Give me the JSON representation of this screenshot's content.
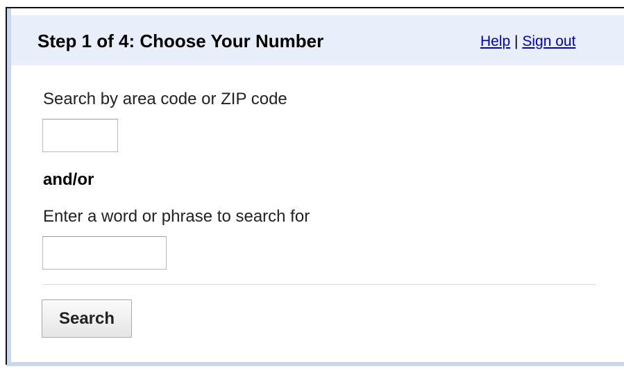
{
  "header": {
    "title": "Step 1 of 4: Choose Your Number",
    "links": {
      "help": "Help",
      "separator": "|",
      "sign_out": "Sign out"
    }
  },
  "form": {
    "area_code": {
      "label": "Search by area code or ZIP code",
      "value": "",
      "placeholder": ""
    },
    "conjunction": "and/or",
    "phrase": {
      "label": "Enter a word or phrase to search for",
      "value": "",
      "placeholder": ""
    },
    "search_button_label": "Search"
  },
  "colors": {
    "header_bg": "#e8eefa",
    "frame_accent": "#c9d7f1",
    "link": "#0000cc"
  }
}
